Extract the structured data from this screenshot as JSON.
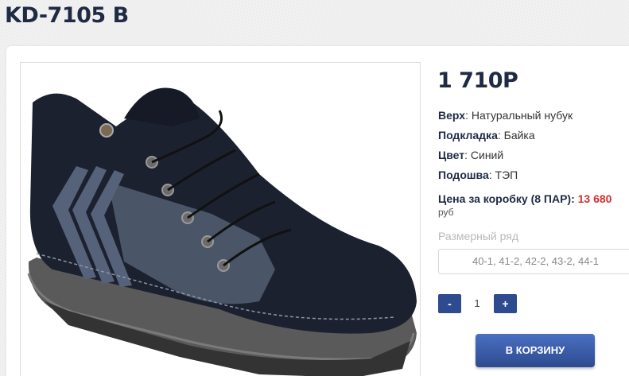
{
  "product": {
    "title": "KD-7105 B",
    "price": "1 710Р",
    "specs": [
      {
        "label": "Верх",
        "value": "Натуральный нубук"
      },
      {
        "label": "Подкладка",
        "value": "Байка"
      },
      {
        "label": "Цвет",
        "value": "Синий"
      },
      {
        "label": "Подошва",
        "value": "ТЭП"
      }
    ],
    "box_price_label": "Цена за коробку (8 ПАР):",
    "box_price_value": "13 680",
    "currency": "руб",
    "image_alt": "shoe-photo"
  },
  "sizes": {
    "label": "Размерный ряд",
    "selected": "40-1, 41-2, 42-2, 43-2, 44-1"
  },
  "quantity": {
    "minus_label": "-",
    "value": "1",
    "plus_label": "+"
  },
  "cart": {
    "button_label": "В КОРЗИНУ"
  },
  "colors": {
    "accent": "#2d4b8e",
    "price_red": "#d32f2f",
    "title_navy": "#1f2a44"
  }
}
